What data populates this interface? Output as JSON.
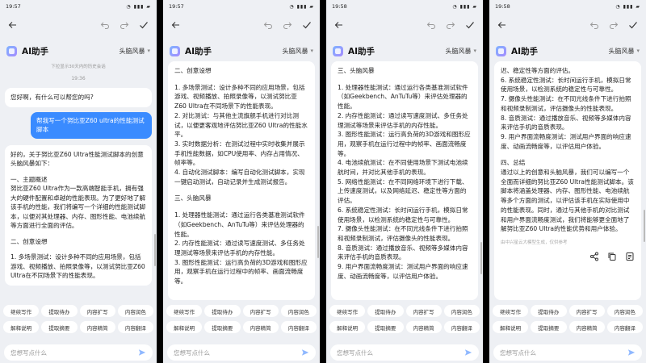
{
  "colors": {
    "background": "#eef0f4",
    "user_bubble": "#3a8bff",
    "send": "#8fb8ff"
  },
  "panels": [
    {
      "time": "19:57",
      "header": {
        "title": "AI助手",
        "mode": "头脑风暴"
      },
      "history_note": "下拉显示30天内的历史会话",
      "chat_time": "19:36",
      "greeting": "您好啊，有什么可以帮您的吗?",
      "user_message": "帮我写一个努比亚Z60 ultra的性能测试脚本",
      "answer_paragraphs": [
        "好的，关于努比亚Z60 Ultra性能测试脚本的创意头脑风暴如下：",
        "",
        "一、主题概述\n努比亚Z60 Ultra作为一款高端智能手机，拥有强大的硬件配置和卓越的性能表现。为了更好地了解该手机的性能，我们将编写一个详细的性能测试脚本，以便对其处理器、内存、图形性能、电池续航等方面进行全面的评估。",
        "",
        "二、创意设想",
        "",
        "1. 多场景测试：设计多种不同的应用场景，包括游戏、视频播放、拍照录像等，以测试努比亚Z60 Ultra在不同场景下的性能表现。"
      ]
    },
    {
      "time": "19:57",
      "header": {
        "title": "AI助手",
        "mode": "头脑风暴"
      },
      "answer_paragraphs": [
        "二、创意设想",
        "",
        "1. 多场景测试：设计多种不同的应用场景，包括游戏、视频播放、拍照录像等，以测试努比亚Z60 Ultra在不同场景下的性能表现。\n2. 对比测试：与其他主流旗舰手机进行对比测试，以便更客观地评估努比亚Z60 Ultra的性能水平。\n3. 实时数据分析：在测试过程中实时收集并展示手机性能数据，如CPU使用率、内存占用情况、帧率等。\n4. 自动化测试脚本：编写自动化测试脚本，实现一键启动测试，自动记录并生成测试报告。",
        "",
        "三、头脑风暴",
        "",
        "1. 处理器性能测试：通过运行各类基准测试软件（如Geekbench、AnTuTu等）来评估处理器的性能。\n2. 内存性能测试：通过读写速度测试、多任务处理测试等场景来评估手机的内存性能。\n3. 图形性能测试：运行高负荷的3D游戏和图形应用，观察手机在运行过程中的帧率、画面流畅度等。"
      ]
    },
    {
      "time": "19:58",
      "header": {
        "title": "AI助手",
        "mode": "头脑风暴"
      },
      "answer_paragraphs": [
        "三、头脑风暴",
        "",
        "1. 处理器性能测试：通过运行各类基准测试软件（如Geekbench、AnTuTu等）来评估处理器的性能。\n2. 内存性能测试：通过读写速度测试、多任务处理测试等场景来评估手机的内存性能。\n3. 图形性能测试：运行高负荷的3D游戏和图形应用，观察手机在运行过程中的帧率、画面流畅度等。\n4. 电池续航测试：在不同使用场景下测试电池续航时间，并对比其他手机的表现。\n5. 网络性能测试：在不同网络环境下进行下载、上传速度测试，以及网络延迟、稳定性等方面的评估。\n6. 系统稳定性测试：长时间运行手机，模拟日常使用场景，以检测系统的稳定性与可靠性。\n7. 摄像头性能测试：在不同光线条件下进行拍照和视频录制测试，评估摄像头的性能表现。\n8. 音质测试：通过播放音乐、视频等多媒体内容来评估手机的音质表现。\n9. 用户界面流畅度测试：测试用户界面的响应速度、动画流畅度等，以评估用户体验。"
      ]
    },
    {
      "time": "19:58",
      "header": {
        "title": "AI助手",
        "mode": "头脑风暴"
      },
      "answer_paragraphs": [
        "迟、稳定性等方面的评估。\n6. 系统稳定性测试：长时间运行手机，模拟日常使用场景，以检测系统的稳定性与可靠性。\n7. 摄像头性能测试：在不同光线条件下进行拍照和视频录制测试，评估摄像头的性能表现。\n8. 音质测试：通过播放音乐、视频等多媒体内容来评估手机的音质表现。\n9. 用户界面流畅度测试：测试用户界面的响应速度、动画流畅度等，以评估用户体验。",
        "",
        "四、总结\n通过以上的创意和头脑风暴，我们可以编写一个全面而详细的努比亚Z60 Ultra性能测试脚本。该脚本将涵盖处理器、内存、图形性能、电池续航等多个方面的测试，以评估该手机在实际使用中的性能表现。同时，通过与其他手机的对比测试和用户界面流畅度测试，我们将能够更全面地了解努比亚Z60 Ultra的性能优势和用户体验。"
      ],
      "disclaimer": "由中兴星云大模型生成，仅供参考"
    }
  ],
  "chips": [
    "继续写作",
    "提取待办",
    "内容扩写",
    "内容润色",
    "解释说明",
    "提取摘要",
    "内容精简",
    "内容翻译"
  ],
  "input_placeholder": "您想写点什么"
}
